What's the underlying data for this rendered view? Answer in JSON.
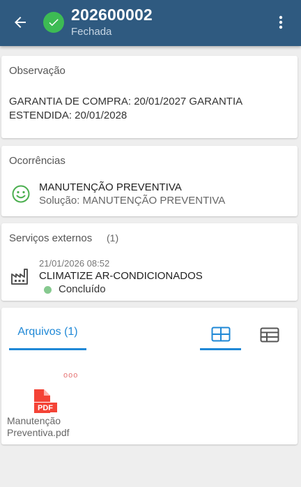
{
  "header": {
    "title": "202600002",
    "subtitle": "Fechada",
    "icons": {
      "back": "arrow-left-icon",
      "status": "check-circle-icon",
      "menu": "more-vertical-icon"
    },
    "colors": {
      "bar": "#2f5a80",
      "status": "#3dbb54"
    }
  },
  "observacao": {
    "label": "Observação",
    "text": "GARANTIA DE COMPRA: 20/01/2027 GARANTIA ESTENDIDA: 20/01/2028"
  },
  "ocorrencias": {
    "label": "Ocorrências",
    "icon": "smiley-icon",
    "items": [
      {
        "title": "MANUTENÇÃO PREVENTIVA",
        "solution": "Solução: MANUTENÇÃO PREVENTIVA"
      }
    ]
  },
  "servicos_externos": {
    "label": "Serviços externos",
    "count": "(1)",
    "icon": "factory-icon",
    "items": [
      {
        "date": "21/01/2026 08:52",
        "name": "CLIMATIZE AR-CONDICIONADOS",
        "status": "Concluído",
        "status_color": "#86c98f"
      }
    ]
  },
  "arquivos": {
    "tab_label": "Arquivos (1)",
    "view_icons": {
      "grid": "grid-view-icon",
      "table": "table-view-icon"
    },
    "accent": "#1f88d6",
    "files": [
      {
        "name": "Manutenção Preventiva.pdf",
        "type_label": "PDF",
        "menu": "ooo",
        "icon": "pdf-file-icon"
      }
    ]
  }
}
